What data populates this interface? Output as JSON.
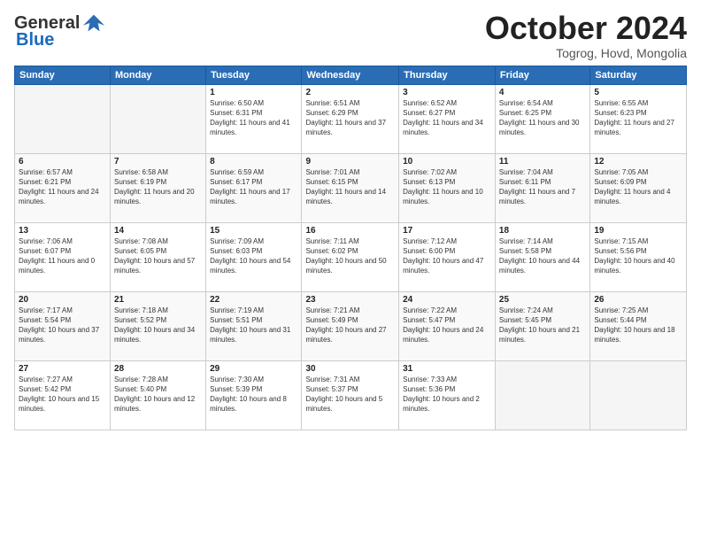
{
  "header": {
    "logo_general": "General",
    "logo_blue": "Blue",
    "month_title": "October 2024",
    "location": "Togrog, Hovd, Mongolia"
  },
  "calendar": {
    "days_of_week": [
      "Sunday",
      "Monday",
      "Tuesday",
      "Wednesday",
      "Thursday",
      "Friday",
      "Saturday"
    ],
    "weeks": [
      [
        {
          "day": "",
          "empty": true
        },
        {
          "day": "",
          "empty": true
        },
        {
          "day": "1",
          "sunrise": "6:50 AM",
          "sunset": "6:31 PM",
          "daylight": "11 hours and 41 minutes."
        },
        {
          "day": "2",
          "sunrise": "6:51 AM",
          "sunset": "6:29 PM",
          "daylight": "11 hours and 37 minutes."
        },
        {
          "day": "3",
          "sunrise": "6:52 AM",
          "sunset": "6:27 PM",
          "daylight": "11 hours and 34 minutes."
        },
        {
          "day": "4",
          "sunrise": "6:54 AM",
          "sunset": "6:25 PM",
          "daylight": "11 hours and 30 minutes."
        },
        {
          "day": "5",
          "sunrise": "6:55 AM",
          "sunset": "6:23 PM",
          "daylight": "11 hours and 27 minutes."
        }
      ],
      [
        {
          "day": "6",
          "sunrise": "6:57 AM",
          "sunset": "6:21 PM",
          "daylight": "11 hours and 24 minutes."
        },
        {
          "day": "7",
          "sunrise": "6:58 AM",
          "sunset": "6:19 PM",
          "daylight": "11 hours and 20 minutes."
        },
        {
          "day": "8",
          "sunrise": "6:59 AM",
          "sunset": "6:17 PM",
          "daylight": "11 hours and 17 minutes."
        },
        {
          "day": "9",
          "sunrise": "7:01 AM",
          "sunset": "6:15 PM",
          "daylight": "11 hours and 14 minutes."
        },
        {
          "day": "10",
          "sunrise": "7:02 AM",
          "sunset": "6:13 PM",
          "daylight": "11 hours and 10 minutes."
        },
        {
          "day": "11",
          "sunrise": "7:04 AM",
          "sunset": "6:11 PM",
          "daylight": "11 hours and 7 minutes."
        },
        {
          "day": "12",
          "sunrise": "7:05 AM",
          "sunset": "6:09 PM",
          "daylight": "11 hours and 4 minutes."
        }
      ],
      [
        {
          "day": "13",
          "sunrise": "7:06 AM",
          "sunset": "6:07 PM",
          "daylight": "11 hours and 0 minutes."
        },
        {
          "day": "14",
          "sunrise": "7:08 AM",
          "sunset": "6:05 PM",
          "daylight": "10 hours and 57 minutes."
        },
        {
          "day": "15",
          "sunrise": "7:09 AM",
          "sunset": "6:03 PM",
          "daylight": "10 hours and 54 minutes."
        },
        {
          "day": "16",
          "sunrise": "7:11 AM",
          "sunset": "6:02 PM",
          "daylight": "10 hours and 50 minutes."
        },
        {
          "day": "17",
          "sunrise": "7:12 AM",
          "sunset": "6:00 PM",
          "daylight": "10 hours and 47 minutes."
        },
        {
          "day": "18",
          "sunrise": "7:14 AM",
          "sunset": "5:58 PM",
          "daylight": "10 hours and 44 minutes."
        },
        {
          "day": "19",
          "sunrise": "7:15 AM",
          "sunset": "5:56 PM",
          "daylight": "10 hours and 40 minutes."
        }
      ],
      [
        {
          "day": "20",
          "sunrise": "7:17 AM",
          "sunset": "5:54 PM",
          "daylight": "10 hours and 37 minutes."
        },
        {
          "day": "21",
          "sunrise": "7:18 AM",
          "sunset": "5:52 PM",
          "daylight": "10 hours and 34 minutes."
        },
        {
          "day": "22",
          "sunrise": "7:19 AM",
          "sunset": "5:51 PM",
          "daylight": "10 hours and 31 minutes."
        },
        {
          "day": "23",
          "sunrise": "7:21 AM",
          "sunset": "5:49 PM",
          "daylight": "10 hours and 27 minutes."
        },
        {
          "day": "24",
          "sunrise": "7:22 AM",
          "sunset": "5:47 PM",
          "daylight": "10 hours and 24 minutes."
        },
        {
          "day": "25",
          "sunrise": "7:24 AM",
          "sunset": "5:45 PM",
          "daylight": "10 hours and 21 minutes."
        },
        {
          "day": "26",
          "sunrise": "7:25 AM",
          "sunset": "5:44 PM",
          "daylight": "10 hours and 18 minutes."
        }
      ],
      [
        {
          "day": "27",
          "sunrise": "7:27 AM",
          "sunset": "5:42 PM",
          "daylight": "10 hours and 15 minutes."
        },
        {
          "day": "28",
          "sunrise": "7:28 AM",
          "sunset": "5:40 PM",
          "daylight": "10 hours and 12 minutes."
        },
        {
          "day": "29",
          "sunrise": "7:30 AM",
          "sunset": "5:39 PM",
          "daylight": "10 hours and 8 minutes."
        },
        {
          "day": "30",
          "sunrise": "7:31 AM",
          "sunset": "5:37 PM",
          "daylight": "10 hours and 5 minutes."
        },
        {
          "day": "31",
          "sunrise": "7:33 AM",
          "sunset": "5:36 PM",
          "daylight": "10 hours and 2 minutes."
        },
        {
          "day": "",
          "empty": true
        },
        {
          "day": "",
          "empty": true
        }
      ]
    ]
  }
}
